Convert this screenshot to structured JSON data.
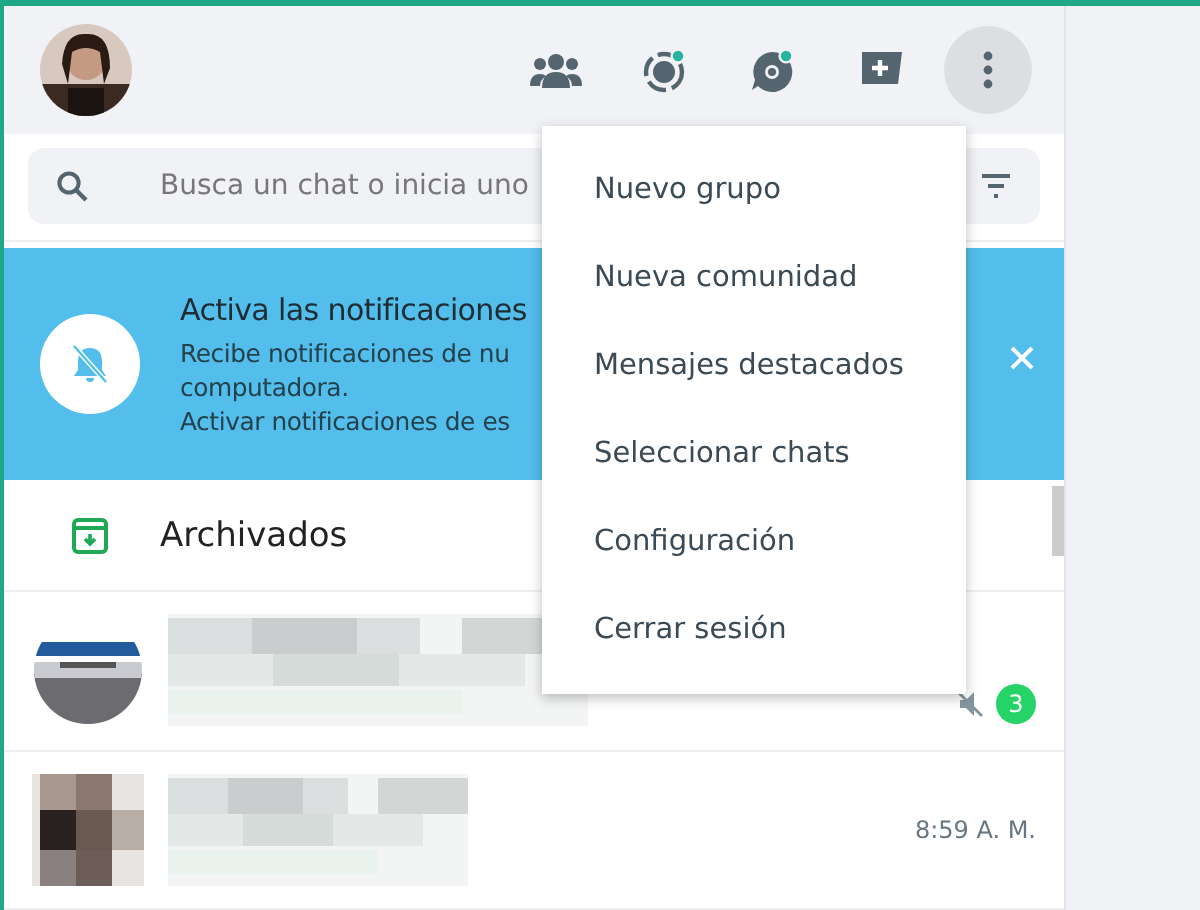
{
  "header": {
    "menu_expanded": true,
    "status_unread": true,
    "channels_unread": true
  },
  "search": {
    "placeholder": "Busca un chat o inicia uno"
  },
  "banner": {
    "title": "Activa las notificaciones",
    "lines": [
      "Recibe notificaciones de nu",
      "computadora.",
      "Activar notificaciones de es"
    ]
  },
  "archived": {
    "label": "Archivados"
  },
  "chats": [
    {
      "muted": true,
      "unread": "3"
    },
    {
      "time": "8:59 A. M.",
      "muted": false
    }
  ],
  "menu": {
    "items": [
      "Nuevo grupo",
      "Nueva comunidad",
      "Mensajes destacados",
      "Seleccionar chats",
      "Configuración",
      "Cerrar sesión"
    ]
  }
}
